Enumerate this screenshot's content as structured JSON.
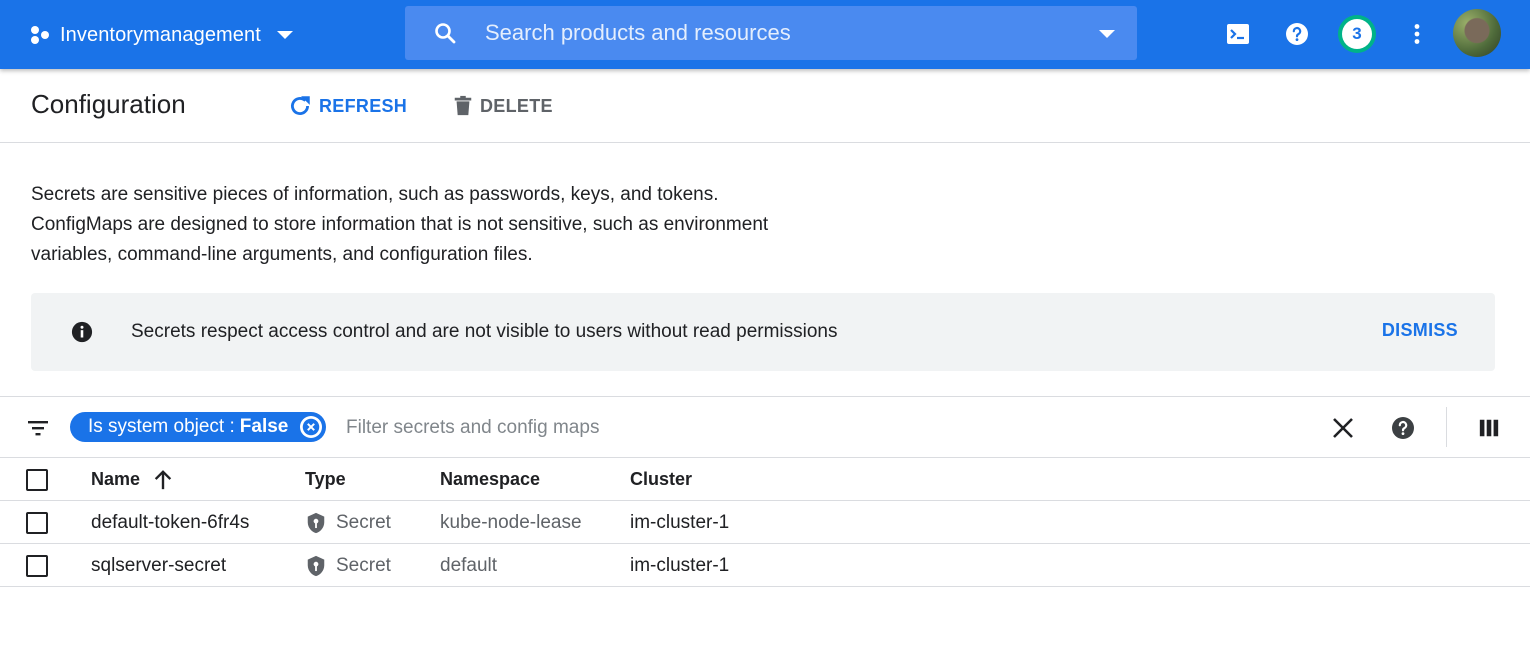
{
  "topbar": {
    "project_name": "Inventorymanagement",
    "search_placeholder": "Search products and resources",
    "notification_count": "3",
    "colors": {
      "bar": "#1a73e8",
      "badge_ring": "#00b388"
    }
  },
  "header": {
    "title": "Configuration",
    "refresh_label": "REFRESH",
    "delete_label": "DELETE"
  },
  "description": {
    "line1": "Secrets are sensitive pieces of information, such as passwords, keys, and tokens.",
    "line2": "ConfigMaps are designed to store information that is not sensitive, such as environment",
    "line3": "variables, command-line arguments, and configuration files."
  },
  "banner": {
    "text": "Secrets respect access control and are not visible to users without read permissions",
    "dismiss_label": "DISMISS"
  },
  "filter": {
    "chip_key": "Is system object :",
    "chip_value": "False",
    "placeholder": "Filter secrets and config maps"
  },
  "table": {
    "columns": {
      "name": "Name",
      "type": "Type",
      "namespace": "Namespace",
      "cluster": "Cluster"
    },
    "rows": [
      {
        "name": "default-token-6fr4s",
        "type": "Secret",
        "namespace": "kube-node-lease",
        "cluster": "im-cluster-1"
      },
      {
        "name": "sqlserver-secret",
        "type": "Secret",
        "namespace": "default",
        "cluster": "im-cluster-1"
      }
    ]
  },
  "icons": {
    "project": "project-dots-icon",
    "search": "search-icon",
    "cloud_shell": "cloud-shell-icon",
    "help": "help-icon",
    "more": "more-vert-icon",
    "refresh": "refresh-icon",
    "delete": "trash-icon",
    "info": "info-icon",
    "filter": "filter-list-icon",
    "clear": "close-icon",
    "columns": "column-display-icon",
    "sort": "arrow-up-icon",
    "secret": "shield-key-icon"
  }
}
